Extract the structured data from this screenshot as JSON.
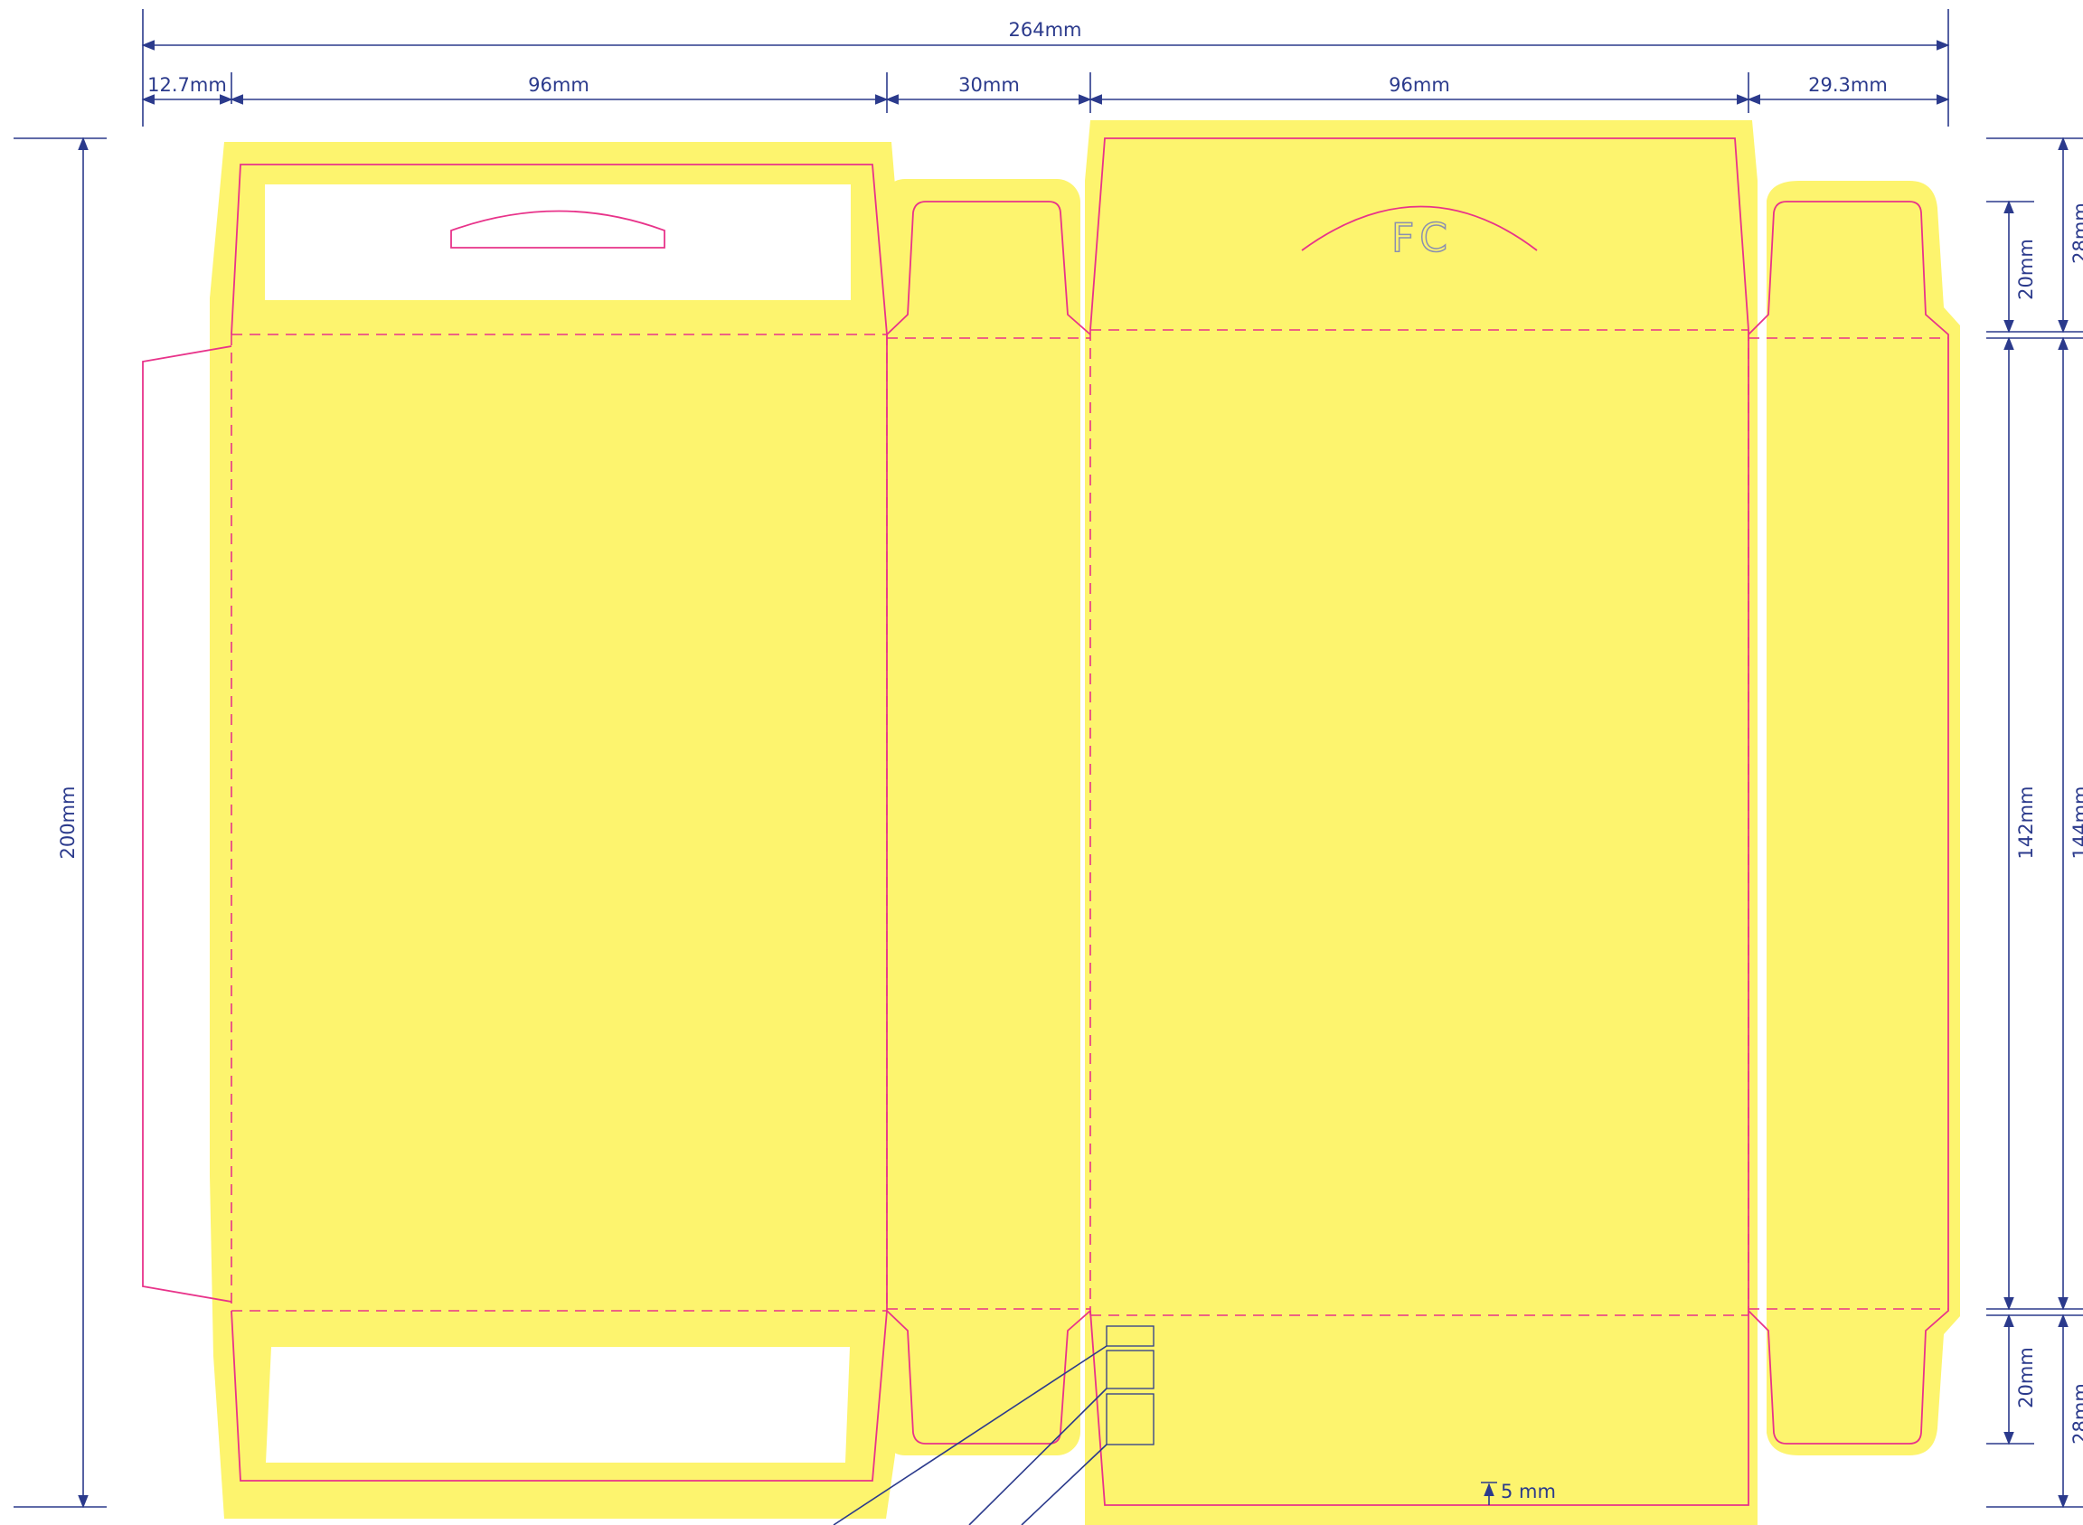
{
  "dimensions": {
    "total_width": "264mm",
    "glue_flap": "12.7mm",
    "back_panel": "96mm",
    "side_panel": "30mm",
    "front_panel": "96mm",
    "side_flap": "29.3mm",
    "total_height": "200mm",
    "top_tuck": "20mm",
    "top_tuck_outer": "28mm",
    "body_height": "142mm",
    "body_height_outer": "144mm",
    "bottom_tuck": "20mm",
    "bottom_tuck_outer": "28mm",
    "bleed_offset": "5 mm"
  },
  "front_panel_label": "FC",
  "colors": {
    "background": "#fdf46e",
    "cut_line": "#e8338a",
    "dimension_line": "#2b3a8c"
  }
}
